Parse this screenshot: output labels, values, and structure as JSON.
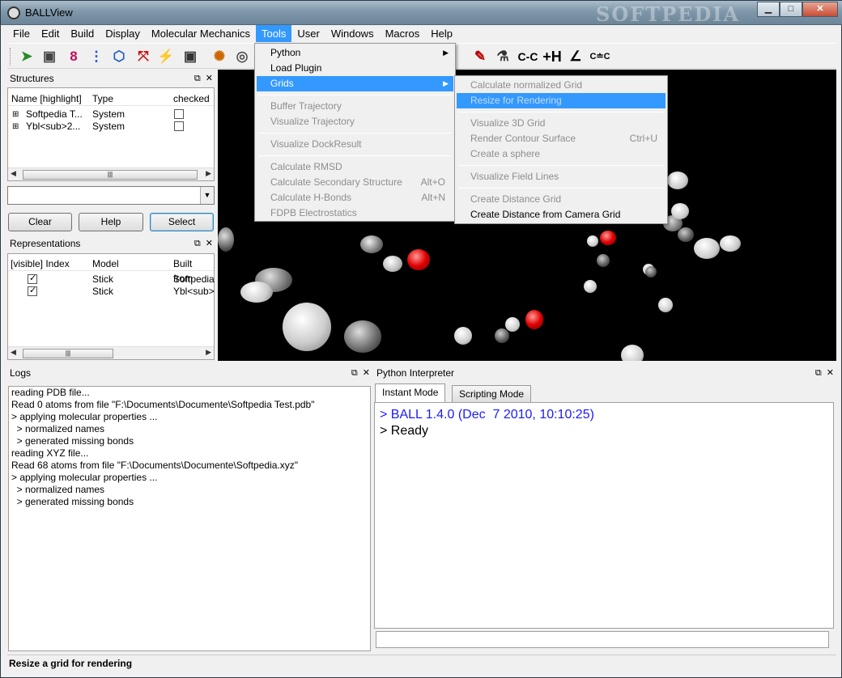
{
  "window": {
    "title": "BALLView",
    "watermark": "SOFTPEDIA",
    "minimize": "▁",
    "maximize": "□",
    "close": "✕"
  },
  "menubar": [
    "File",
    "Edit",
    "Build",
    "Display",
    "Molecular Mechanics",
    "Tools",
    "User",
    "Windows",
    "Macros",
    "Help"
  ],
  "toolbar_icons": [
    "open-icon",
    "save-icon",
    "bond-order-icon",
    "hydrogen-icon",
    "ring-icon",
    "minimize-icon",
    "lightning-icon",
    "save-image-icon",
    "palette-icon",
    "target-icon",
    "edit-icon",
    "flask-icon",
    "cc-icon",
    "add-h-icon",
    "angle-icon",
    "chain-icon"
  ],
  "toolbar_glyphs": {
    "cc": "C-C",
    "addh": "+H",
    "angle": "∠",
    "chain": "C≐C"
  },
  "structures": {
    "title": "Structures",
    "columns": [
      "Name [highlight]",
      "Type",
      "checked"
    ],
    "rows": [
      {
        "name": "Softpedia T...",
        "type": "System"
      },
      {
        "name": "Ybl<sub>2...",
        "type": "System"
      }
    ]
  },
  "buttons": {
    "clear": "Clear",
    "help": "Help",
    "select": "Select"
  },
  "representations": {
    "title": "Representations",
    "columns": [
      "[visible] Index",
      "Model",
      "Built from"
    ],
    "rows": [
      {
        "model": "Stick",
        "built": "Softpedia"
      },
      {
        "model": "Stick",
        "built": "Ybl<sub>"
      }
    ]
  },
  "logs": {
    "title": "Logs",
    "lines": [
      "reading PDB file...",
      "Read 0 atoms from file \"F:\\Documents\\Documente\\Softpedia Test.pdb\"",
      "> applying molecular properties ...",
      "  > normalized names",
      "  > generated missing bonds",
      "reading XYZ file...",
      "Read 68 atoms from file \"F:\\Documents\\Documente\\Softpedia.xyz\"",
      "> applying molecular properties ...",
      "  > normalized names",
      "  > generated missing bonds"
    ]
  },
  "python": {
    "title": "Python Interpreter",
    "tabs": [
      "Instant Mode",
      "Scripting Mode"
    ],
    "lines": [
      "> BALL 1.4.0 (Dec  7 2010, 10:10:25)",
      "> Ready"
    ],
    "version_color": "#1a1aff"
  },
  "tools_menu": [
    {
      "label": "Python",
      "submenu": true,
      "enabled": true
    },
    {
      "label": "Load Plugin",
      "enabled": true
    },
    {
      "label": "Grids",
      "submenu": true,
      "enabled": true,
      "highlighted": true
    },
    {
      "sep": true
    },
    {
      "label": "Buffer Trajectory",
      "enabled": false
    },
    {
      "label": "Visualize Trajectory",
      "enabled": false
    },
    {
      "sep": true
    },
    {
      "label": "Visualize DockResult",
      "enabled": false
    },
    {
      "sep": true
    },
    {
      "label": "Calculate RMSD",
      "enabled": false
    },
    {
      "label": "Calculate Secondary Structure",
      "shortcut": "Alt+O",
      "enabled": false
    },
    {
      "label": "Calculate H-Bonds",
      "shortcut": "Alt+N",
      "enabled": false
    },
    {
      "label": "FDPB Electrostatics",
      "enabled": false
    }
  ],
  "grids_menu": [
    {
      "label": "Calculate normalized Grid",
      "enabled": false
    },
    {
      "label": "Resize for Rendering",
      "enabled": false,
      "highlighted": true
    },
    {
      "sep": true
    },
    {
      "label": "Visualize 3D Grid",
      "enabled": false
    },
    {
      "label": "Render Contour Surface",
      "shortcut": "Ctrl+U",
      "enabled": false
    },
    {
      "label": "Create a sphere",
      "enabled": false
    },
    {
      "sep": true
    },
    {
      "label": "Visualize Field Lines",
      "enabled": false
    },
    {
      "sep": true
    },
    {
      "label": "Create Distance Grid",
      "enabled": false
    },
    {
      "label": "Create Distance from Camera Grid",
      "enabled": true
    }
  ],
  "status": "Resize a grid for rendering",
  "colors": {
    "highlight": "#3399ff",
    "atom_red": "#e00000",
    "viewer_bg": "#000000"
  }
}
